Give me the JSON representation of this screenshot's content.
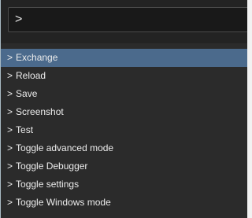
{
  "command_palette": {
    "input_value": ">",
    "items": [
      {
        "prefix": ">",
        "label": "Exchange",
        "selected": true
      },
      {
        "prefix": ">",
        "label": "Reload",
        "selected": false
      },
      {
        "prefix": ">",
        "label": "Save",
        "selected": false
      },
      {
        "prefix": ">",
        "label": "Screenshot",
        "selected": false
      },
      {
        "prefix": ">",
        "label": "Test",
        "selected": false
      },
      {
        "prefix": ">",
        "label": "Toggle advanced mode",
        "selected": false
      },
      {
        "prefix": ">",
        "label": "Toggle Debugger",
        "selected": false
      },
      {
        "prefix": ">",
        "label": "Toggle settings",
        "selected": false
      },
      {
        "prefix": ">",
        "label": "Toggle Windows mode",
        "selected": false
      }
    ]
  },
  "colors": {
    "panel_background": "#2b2b2b",
    "input_background": "#191919",
    "selected_background": "#4b6a8c",
    "text": "#ececec"
  }
}
